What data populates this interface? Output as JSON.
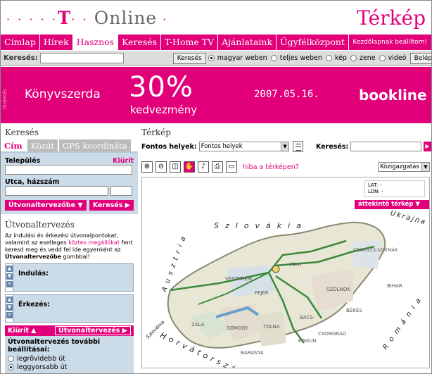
{
  "header": {
    "logo_dots": "· · · · ·",
    "logo_t": "T",
    "logo_sep": "· · ",
    "logo_online": "Online",
    "logo_tail": " ·",
    "title": "Térkép"
  },
  "nav": {
    "items": [
      "Címlap",
      "Hírek",
      "Hasznos",
      "Keresés",
      "T-Home TV",
      "Ajánlataink",
      "Ügyfélközpont"
    ],
    "active": "Hasznos",
    "right": "Kezdőlapnak beállítom!"
  },
  "searchbar": {
    "label": "Keresés:",
    "value": "",
    "button": "Keresés",
    "options": [
      "magyar weben",
      "teljes weben",
      "kép",
      "zene",
      "videó"
    ],
    "selected": "magyar weben",
    "login": "Belépés"
  },
  "banner": {
    "side": "hirdetés",
    "left": "Könyvszerda",
    "pct": "30%",
    "sub": "kedvezmény",
    "date": "2007.05.16.",
    "brand": "bookline"
  },
  "left": {
    "title": "Keresés",
    "tabs": [
      "Cím",
      "Közút",
      "GPS koordináta"
    ],
    "active_tab": "Cím",
    "city_label": "Település",
    "clear": "Kiürít",
    "street_label": "Utca, házszám",
    "to_planner": "Útvonaltervezőbe ▼",
    "search_btn": "Keresés ▶",
    "plan_title": "Útvonaltervezés",
    "plan_text_1": "Az indulási és érkezési útvonalpontokat, valamint az esetleges ",
    "plan_link": "köztes megállókat",
    "plan_text_2": " fent keresd meg és vedd fel ide egyenként az ",
    "plan_bold": "Útvonaltervezőbe",
    "plan_text_3": " gombbal!",
    "start": "Indulás:",
    "end": "Érkezés:",
    "clear_btn": "Kiürít ▲",
    "plan_btn": "Útvonaltervezés ▶",
    "more_settings": "Útvonaltervezés további beállításai:",
    "route_opts": [
      "legrövidebb út",
      "leggyorsabb út"
    ],
    "route_selected": "leggyorsabb út"
  },
  "map": {
    "title": "Térkép",
    "fontos_label": "Fontos helyek:",
    "fontos_value": "Fontos helyek",
    "search_label": "Keresés:",
    "search_value": "",
    "error_link": "hiba a térképen?",
    "layer_value": "Közigazgatás",
    "lat": "LAT:  -",
    "lon": "LON:  -",
    "overview": "áttekintő térkép  ▼",
    "labels": [
      "Szlovákia",
      "Ukrajna",
      "Ausztria",
      "Románia",
      "Horvátország",
      "Szlovénia",
      "SOMOGY",
      "TOLNA",
      "BARANYA",
      "ZALA",
      "BÁCS-",
      "BÉKÉS",
      "BIHAR",
      "SZOLNOK",
      "SZABOLCS-SZATMÁR",
      "VESZPRÉM",
      "FEJÉR",
      "KISKUN",
      "CSONGRÁD",
      "PEST"
    ]
  }
}
